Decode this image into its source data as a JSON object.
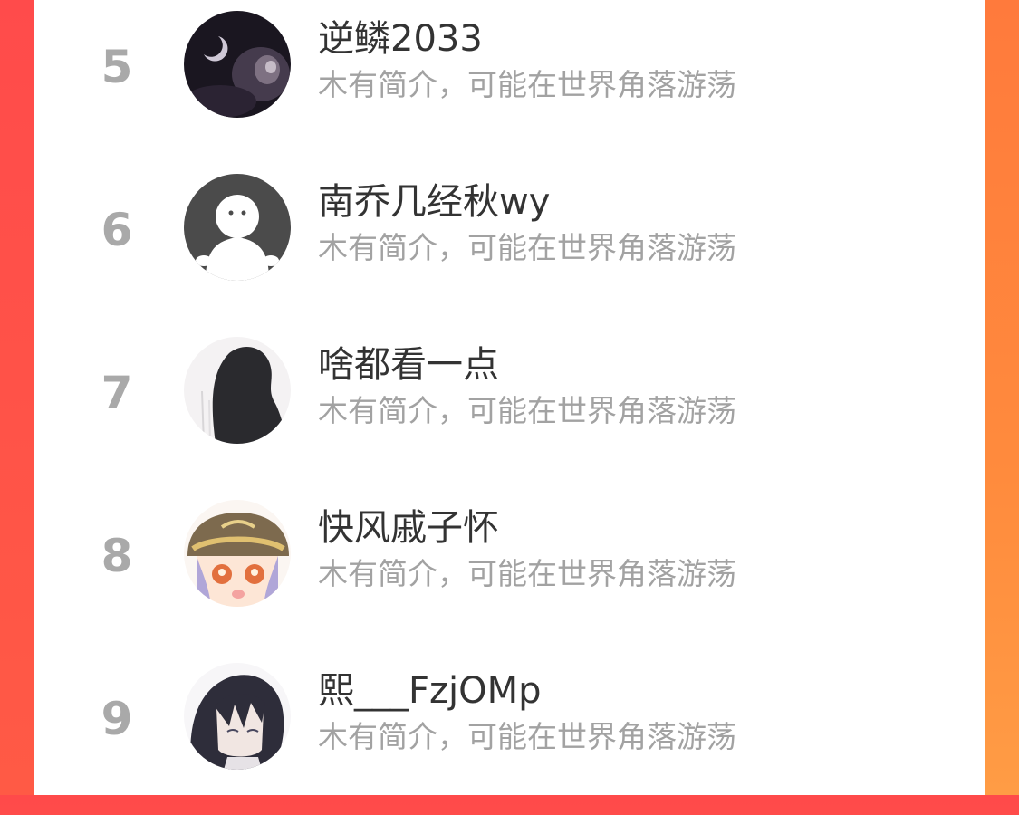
{
  "theme": {
    "accent_left": "#ff4b4b",
    "accent_right": "#ff8b3d",
    "card_background": "#ffffff",
    "rank_color": "#a9a9a9",
    "name_color": "#333333",
    "bio_color": "#a2a2a2"
  },
  "ranking": {
    "entries": [
      {
        "rank": "5",
        "name": "逆鳞2033",
        "bio": "木有简介，可能在世界角落游荡",
        "avatar": "dark-moon-avatar"
      },
      {
        "rank": "6",
        "name": "南乔几经秋wy",
        "bio": "木有简介，可能在世界角落游荡",
        "avatar": "default-user-avatar"
      },
      {
        "rank": "7",
        "name": "啥都看一点",
        "bio": "木有简介，可能在世界角落游荡",
        "avatar": "silhouette-avatar"
      },
      {
        "rank": "8",
        "name": "快风戚子怀",
        "bio": "木有简介，可能在世界角落游荡",
        "avatar": "anime-girl-avatar"
      },
      {
        "rank": "9",
        "name": "熙___FzjOMp",
        "bio": "木有简介，可能在世界角落游荡",
        "avatar": "anime-boy-avatar"
      }
    ]
  }
}
